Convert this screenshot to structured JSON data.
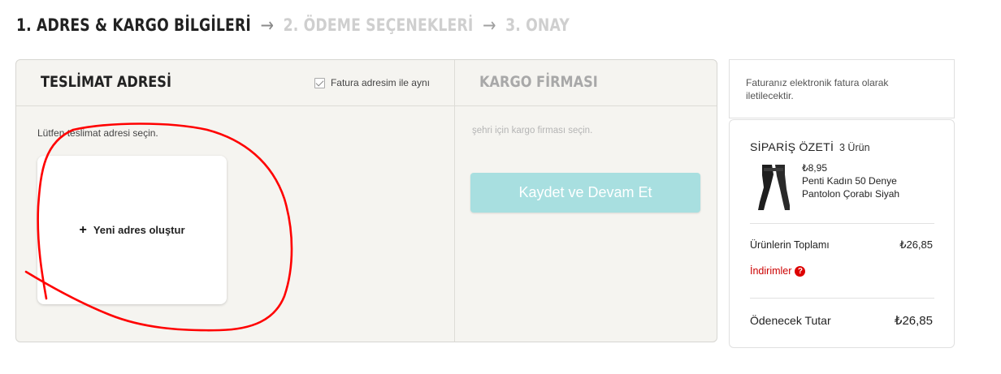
{
  "steps": {
    "step1": "1. ADRES & KARGO BİLGİLERİ",
    "step2": "2. ÖDEME SEÇENEKLERİ",
    "step3": "3. ONAY",
    "arrow": "→"
  },
  "delivery": {
    "title": "TESLİMAT ADRESİ",
    "billing_same_label": "Fatura adresim ile aynı",
    "billing_same_checked": true,
    "hint": "Lütfen teslimat adresi seçin.",
    "new_address_icon": "+",
    "new_address_label": "Yeni adres oluştur"
  },
  "cargo": {
    "title": "KARGO FİRMASI",
    "hint": "şehri için kargo firması seçin.",
    "save_button": "Kaydet ve Devam Et"
  },
  "einvoice": {
    "text": "Faturanız elektronik fatura olarak iletilecektir."
  },
  "summary": {
    "title": "SİPARİŞ ÖZETİ",
    "count": "3 Ürün",
    "product": {
      "price": "₺8,95",
      "name": "Penti Kadın 50 Denye Pantolon Çorabı Siyah"
    },
    "subtotal_label": "Ürünlerin Toplamı",
    "subtotal_value": "₺26,85",
    "discounts_label": "İndirimler",
    "discounts_help_icon": "?",
    "total_label": "Ödenecek Tutar",
    "total_value": "₺26,85"
  },
  "colors": {
    "accent_button": "#a8dfe0",
    "discount_red": "#cc0000",
    "annotation_red": "#ff0000"
  }
}
